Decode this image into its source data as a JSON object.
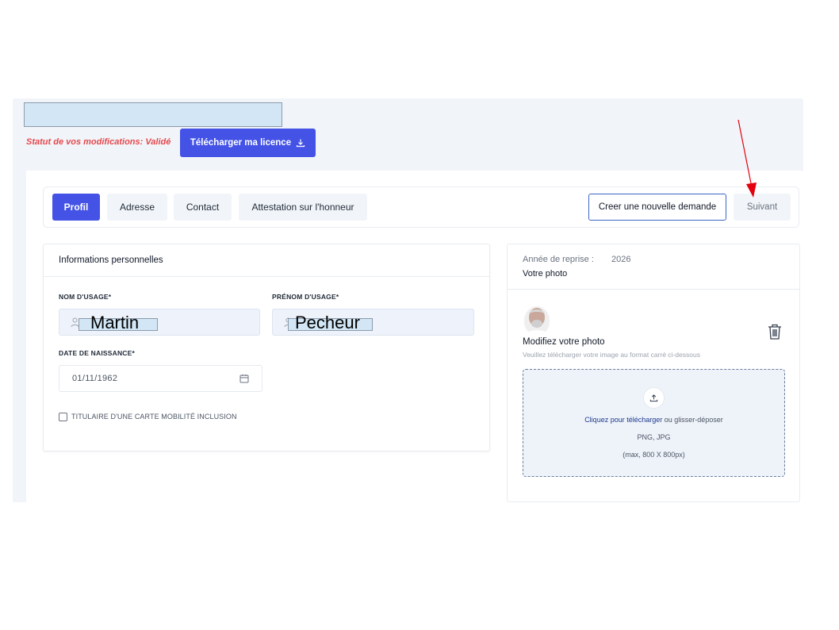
{
  "status": {
    "text": "Statut de vos modifications: Validé",
    "color": "#e5484d"
  },
  "download_button": {
    "label": "Télécharger ma licence",
    "icon": "download-icon",
    "color": "#4453e6"
  },
  "tabs": [
    {
      "label": "Profil",
      "active": true
    },
    {
      "label": "Adresse",
      "active": false
    },
    {
      "label": "Contact",
      "active": false
    },
    {
      "label": "Attestation sur l'honneur",
      "active": false
    }
  ],
  "actions": {
    "new_request": "Creer une nouvelle demande",
    "next": "Suivant"
  },
  "personal_info": {
    "title": "Informations personnelles",
    "last_name": {
      "label": "NOM D'USAGE*",
      "value": "Martin",
      "icon": "user-icon"
    },
    "first_name": {
      "label": "PRÉNOM D'USAGE*",
      "value": "Pecheur",
      "icon": "user-icon"
    },
    "birth_date": {
      "label": "DATE DE NAISSANCE*",
      "value": "01/11/1962",
      "icon": "calendar-icon"
    },
    "mobility_card": {
      "label": "TITULAIRE D'UNE CARTE MOBILITÉ INCLUSION",
      "checked": false
    }
  },
  "photo_panel": {
    "year_label": "Année de reprise :",
    "year_value": "2026",
    "title": "Votre photo",
    "modify_title": "Modifiez votre photo",
    "modify_hint": "Veuillez télécharger votre image au format carré ci-dessous",
    "dropzone": {
      "link": "Cliquez pour télécharger",
      "text": " ou glisser-déposer",
      "formats": "PNG, JPG",
      "size": "(max, 800 X 800px)",
      "icon": "upload-icon"
    },
    "delete_icon": "trash-icon"
  },
  "annotation": {
    "icon": "red-arrow",
    "color": "#e3000f"
  }
}
